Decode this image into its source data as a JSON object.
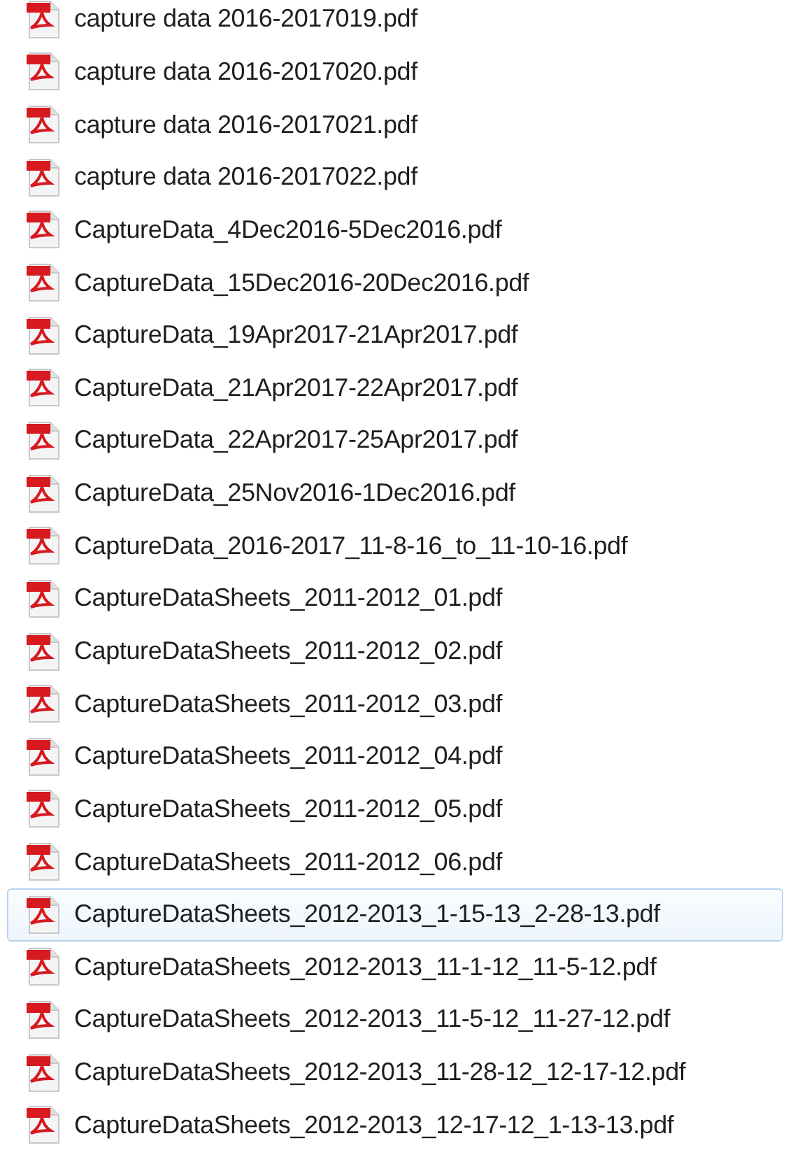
{
  "files": [
    {
      "name": "capture data 2016-2017019.pdf",
      "selected": false
    },
    {
      "name": "capture data 2016-2017020.pdf",
      "selected": false
    },
    {
      "name": "capture data 2016-2017021.pdf",
      "selected": false
    },
    {
      "name": "capture data 2016-2017022.pdf",
      "selected": false
    },
    {
      "name": "CaptureData_4Dec2016-5Dec2016.pdf",
      "selected": false
    },
    {
      "name": "CaptureData_15Dec2016-20Dec2016.pdf",
      "selected": false
    },
    {
      "name": "CaptureData_19Apr2017-21Apr2017.pdf",
      "selected": false
    },
    {
      "name": "CaptureData_21Apr2017-22Apr2017.pdf",
      "selected": false
    },
    {
      "name": "CaptureData_22Apr2017-25Apr2017.pdf",
      "selected": false
    },
    {
      "name": "CaptureData_25Nov2016-1Dec2016.pdf",
      "selected": false
    },
    {
      "name": "CaptureData_2016-2017_11-8-16_to_11-10-16.pdf",
      "selected": false
    },
    {
      "name": "CaptureDataSheets_2011-2012_01.pdf",
      "selected": false
    },
    {
      "name": "CaptureDataSheets_2011-2012_02.pdf",
      "selected": false
    },
    {
      "name": "CaptureDataSheets_2011-2012_03.pdf",
      "selected": false
    },
    {
      "name": "CaptureDataSheets_2011-2012_04.pdf",
      "selected": false
    },
    {
      "name": "CaptureDataSheets_2011-2012_05.pdf",
      "selected": false
    },
    {
      "name": "CaptureDataSheets_2011-2012_06.pdf",
      "selected": false
    },
    {
      "name": "CaptureDataSheets_2012-2013_1-15-13_2-28-13.pdf",
      "selected": true
    },
    {
      "name": "CaptureDataSheets_2012-2013_11-1-12_11-5-12.pdf",
      "selected": false
    },
    {
      "name": "CaptureDataSheets_2012-2013_11-5-12_11-27-12.pdf",
      "selected": false
    },
    {
      "name": "CaptureDataSheets_2012-2013_11-28-12_12-17-12.pdf",
      "selected": false
    },
    {
      "name": "CaptureDataSheets_2012-2013_12-17-12_1-13-13.pdf",
      "selected": false
    }
  ]
}
